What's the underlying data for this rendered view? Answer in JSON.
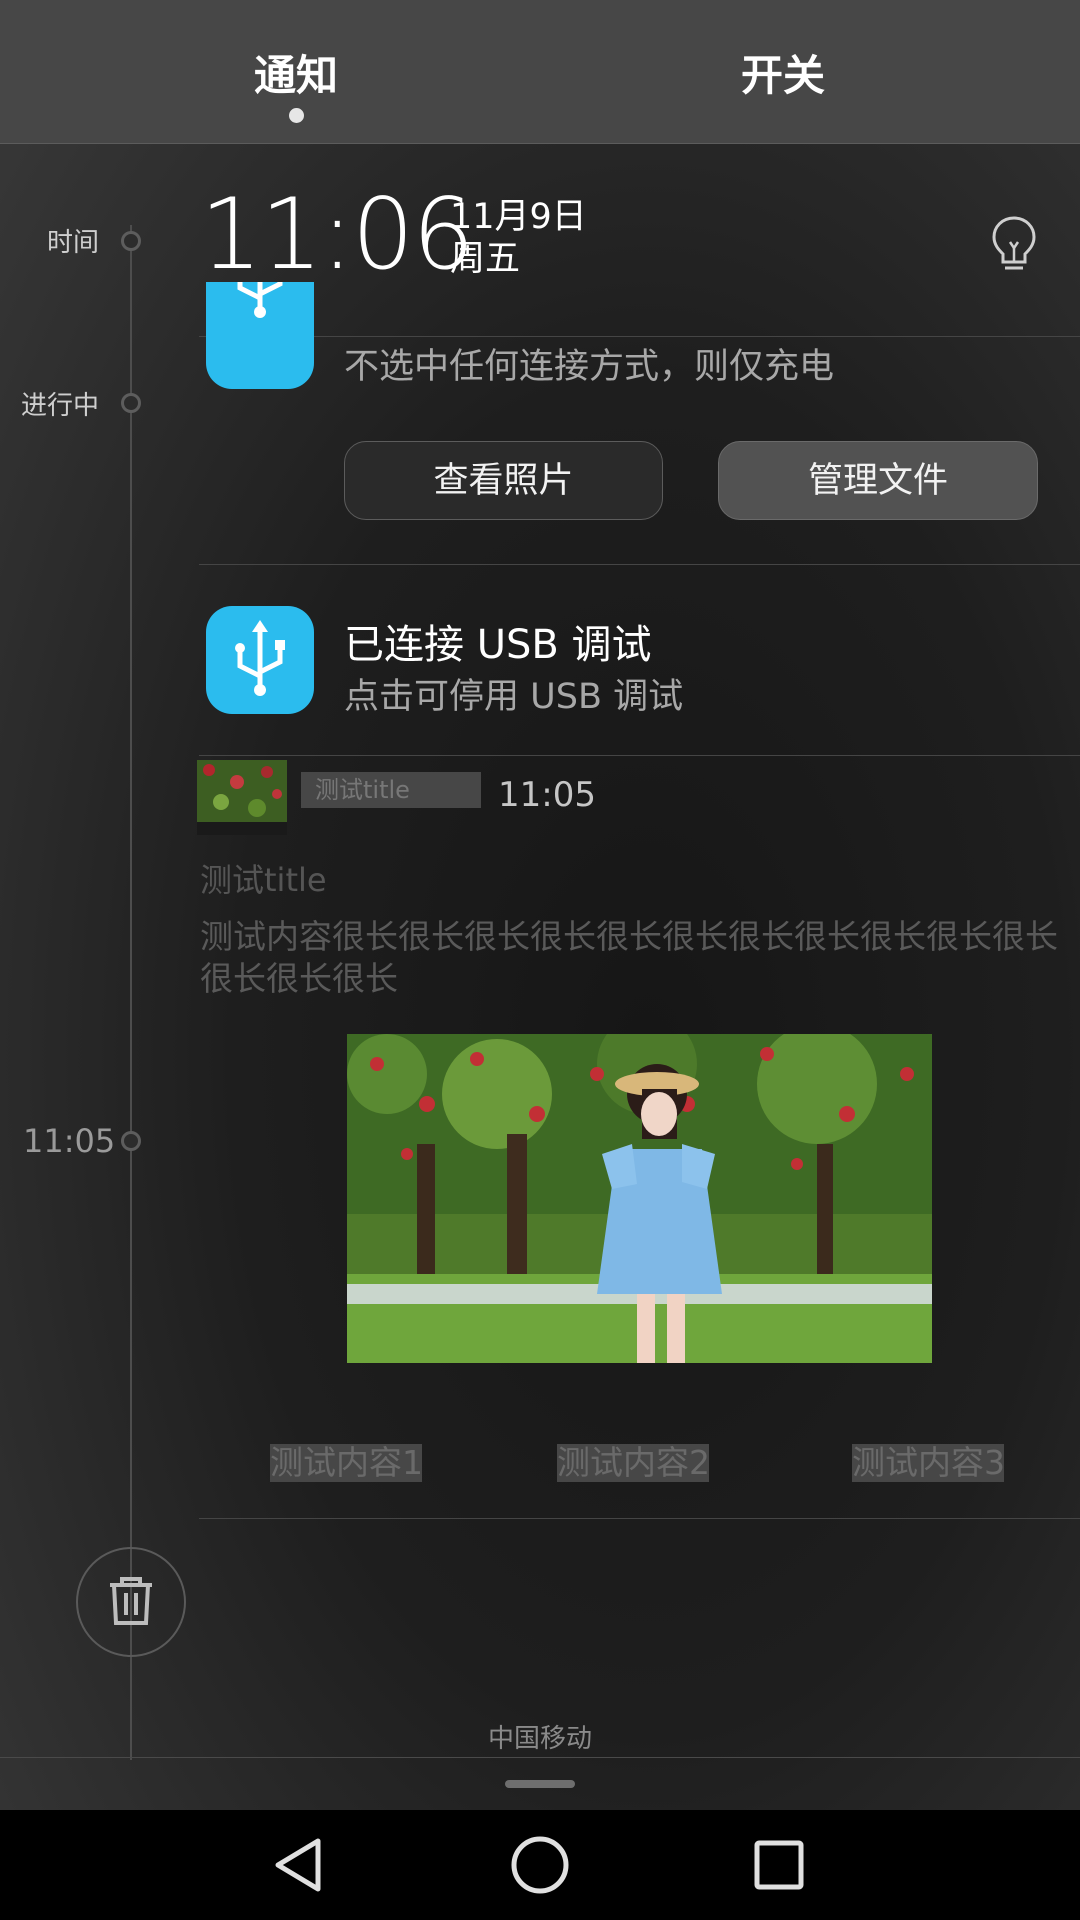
{
  "tabs": {
    "notifications": "通知",
    "switches": "开关"
  },
  "timeline": {
    "time_label": "时间",
    "ongoing_label": "进行中",
    "time_1105": "11:05"
  },
  "header": {
    "clock": "11:06",
    "date": "11月9日",
    "weekday": "周五"
  },
  "usb_charge": {
    "subtitle": "不选中任何连接方式，则仅充电",
    "view_photos_button": "查看照片",
    "manage_files_button": "管理文件"
  },
  "usb_debug": {
    "title": "已连接 USB 调试",
    "subtitle": "点击可停用 USB 调试"
  },
  "custom_notification": {
    "small_title": "测试title",
    "time": "11:05",
    "title": "测试title",
    "content": "测试内容很长很长很长很长很长很长很长很长很长很长很长很长很长很长",
    "actions": [
      "测试内容1",
      "测试内容2",
      "测试内容3"
    ]
  },
  "footer": {
    "carrier": "中国移动"
  },
  "colors": {
    "usb_icon_bg": "#2bbcee",
    "panel_bg": "#1e1e1e"
  }
}
